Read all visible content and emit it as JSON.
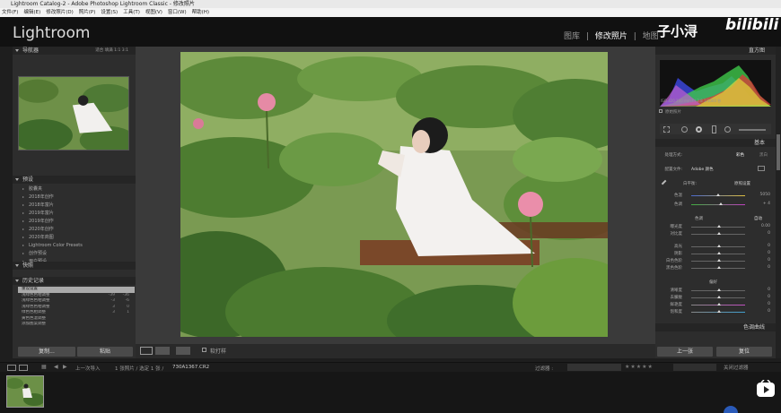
{
  "window": {
    "title": "Lightroom Catalog-2 - Adobe Photoshop Lightroom Classic - 修改照片"
  },
  "menu": [
    "文件(F)",
    "编辑(E)",
    "修改照片(D)",
    "照片(P)",
    "设置(S)",
    "工具(T)",
    "视图(V)",
    "窗口(W)",
    "帮助(H)"
  ],
  "app": {
    "logo": "Lightroom"
  },
  "modules": {
    "library": "图库",
    "sep": "|",
    "develop": "修改照片",
    "map": "地图"
  },
  "watermark": {
    "author": "子小浔",
    "site": "bilibili"
  },
  "navigator": {
    "title": "导航器",
    "options": "适合  填满  1:1  3:1"
  },
  "presets": {
    "title": "预设",
    "items": [
      "胶囊夹",
      "2018年创作",
      "2018年富片",
      "2019年富片",
      "2019年创作",
      "2020年创作",
      "2020年商图",
      "Lightroom Color Presets",
      "创作预设",
      "用户预设"
    ]
  },
  "snapshots": {
    "title": "快照"
  },
  "history": {
    "title": "历史记录",
    "items": [
      {
        "label": "重设设置",
        "a": "",
        "b": ""
      },
      {
        "label": "浅绿色色相调整",
        "a": "-39",
        "b": "-36"
      },
      {
        "label": "浅绿色色相调整",
        "a": "-3",
        "b": "-6"
      },
      {
        "label": "浅绿色色相调整",
        "a": "3",
        "b": "0"
      },
      {
        "label": "绿色色相调整",
        "a": "3",
        "b": "1"
      },
      {
        "label": "黄色色温调整",
        "a": "",
        "b": ""
      },
      {
        "label": "添加图案调整",
        "a": "",
        "b": ""
      }
    ]
  },
  "left_buttons": {
    "copy": "复制...",
    "paste": "粘贴"
  },
  "histogram": {
    "title": "直方图",
    "meta": "ISO 320    200 mm    f / 2.8    1/1000 秒",
    "original": "原始照片"
  },
  "basic": {
    "title": "基本",
    "treatment_label": "处理方式:",
    "treatment_color": "彩色",
    "treatment_bw": "黑白",
    "profile_label": "配置文件:",
    "profile_value": "Adobe 颜色",
    "wb_label": "白平衡:",
    "wb_value": "原照设置",
    "temp_label": "色温",
    "temp_value": "5050",
    "tint_label": "色调",
    "tint_value": "+ 4",
    "tone_label": "色调",
    "tone_auto": "自动",
    "exposure_label": "曝光度",
    "exposure_value": "0.00",
    "contrast_label": "对比度",
    "contrast_value": "0",
    "highlights_label": "高光",
    "highlights_value": "0",
    "shadows_label": "阴影",
    "shadows_value": "0",
    "whites_label": "白色色阶",
    "whites_value": "0",
    "blacks_label": "黑色色阶",
    "blacks_value": "0",
    "presence_label": "偏好",
    "texture_label": "清晰度",
    "texture_value": "0",
    "clarity_label": "去朦胧",
    "clarity_value": "0",
    "vibrance_label": "鲜艳度",
    "vibrance_value": "0",
    "saturation_label": "饱和度",
    "saturation_value": "0"
  },
  "tone_curve": {
    "title": "色调曲线"
  },
  "right_buttons": {
    "previous": "上一张",
    "reset": "复位"
  },
  "toolbar": {
    "softproof": "软打样"
  },
  "filmbar": {
    "source": "上一次导入",
    "count": "1 张照片 / 选定 1 张 /",
    "file": "730A1367.CR2",
    "filter_label": "过滤器 :",
    "filter_off": "关闭过滤器"
  }
}
